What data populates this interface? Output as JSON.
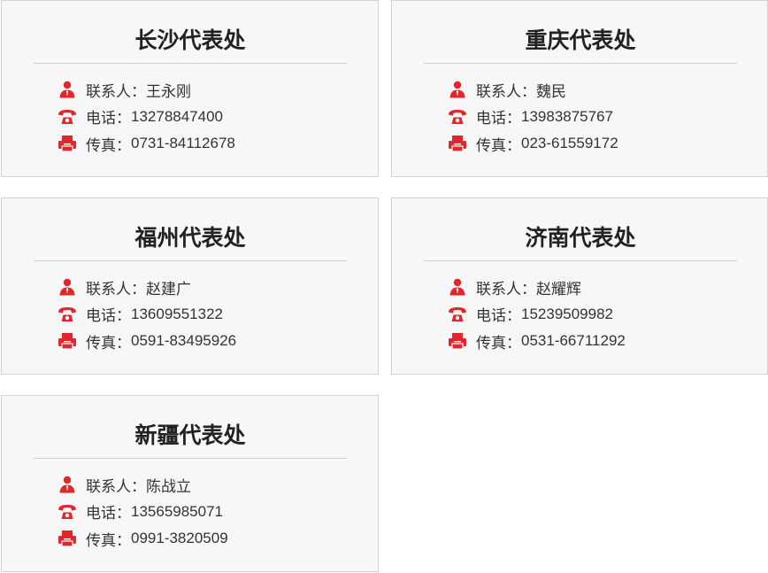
{
  "colors": {
    "icon": "#e2262b",
    "card_bg": "#f7f7f7",
    "border": "#d2d2d2"
  },
  "labels": {
    "contact": "联系人：",
    "phone": "电话：",
    "fax": "传真："
  },
  "offices": [
    {
      "name": "长沙代表处",
      "contact": "王永刚",
      "phone": "13278847400",
      "fax": "0731-84112678"
    },
    {
      "name": "重庆代表处",
      "contact": "魏民",
      "phone": "13983875767",
      "fax": "023-61559172"
    },
    {
      "name": "福州代表处",
      "contact": "赵建广",
      "phone": "13609551322",
      "fax": "0591-83495926"
    },
    {
      "name": "济南代表处",
      "contact": "赵耀辉",
      "phone": "15239509982",
      "fax": "0531-66711292"
    },
    {
      "name": "新疆代表处",
      "contact": "陈战立",
      "phone": "13565985071",
      "fax": "0991-3820509"
    }
  ]
}
